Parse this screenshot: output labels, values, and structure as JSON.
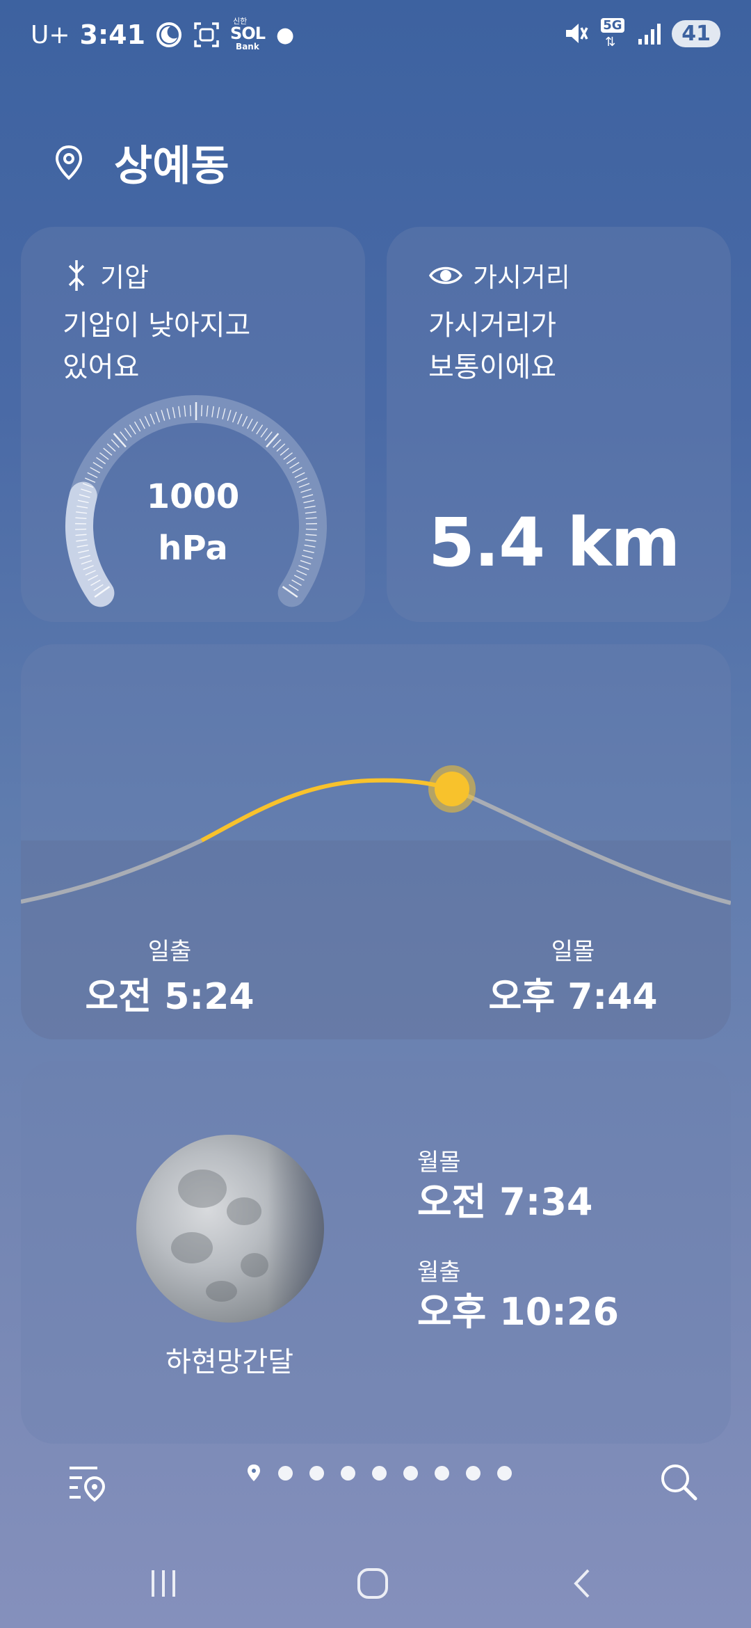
{
  "status_bar": {
    "carrier": "U+",
    "time": "3:41",
    "app_icons": [
      "moon-icon",
      "screenshot-icon",
      "shinhan-sol-bank-icon",
      "dot-icon"
    ],
    "bank_icon_text_top": "신한",
    "bank_icon_text_mid": "SOL",
    "bank_icon_text_bot": "Bank",
    "network": "5G",
    "battery": "41"
  },
  "location": {
    "name": "상예동"
  },
  "pressure_card": {
    "title": "기압",
    "description_line1": "기압이 낮아지고",
    "description_line2": "있어요",
    "value": "1000",
    "unit": "hPa",
    "gauge_level": 0.2
  },
  "visibility_card": {
    "title": "가시거리",
    "description_line1": "가시거리가",
    "description_line2": "보통이에요",
    "value": "5.4 km"
  },
  "sun_card": {
    "sunrise_label": "일출",
    "sunrise_time": "오전 5:24",
    "sunset_label": "일몰",
    "sunset_time": "오후 7:44",
    "colors": {
      "sun": "#f8c22c",
      "curve_day": "#f8c22c",
      "curve_night": "#a9adb5"
    }
  },
  "moon_card": {
    "phase_name": "하현망간달",
    "moonset_label": "월몰",
    "moonset_time": "오전 7:34",
    "moonrise_label": "월출",
    "moonrise_time": "오후 10:26"
  },
  "bottom_bar": {
    "left_icon": "location-list-icon",
    "right_icon": "search-icon",
    "page_count": 9,
    "current_page": 0
  },
  "nav_bar": {
    "icons": [
      "recents-icon",
      "home-icon",
      "back-icon"
    ]
  }
}
